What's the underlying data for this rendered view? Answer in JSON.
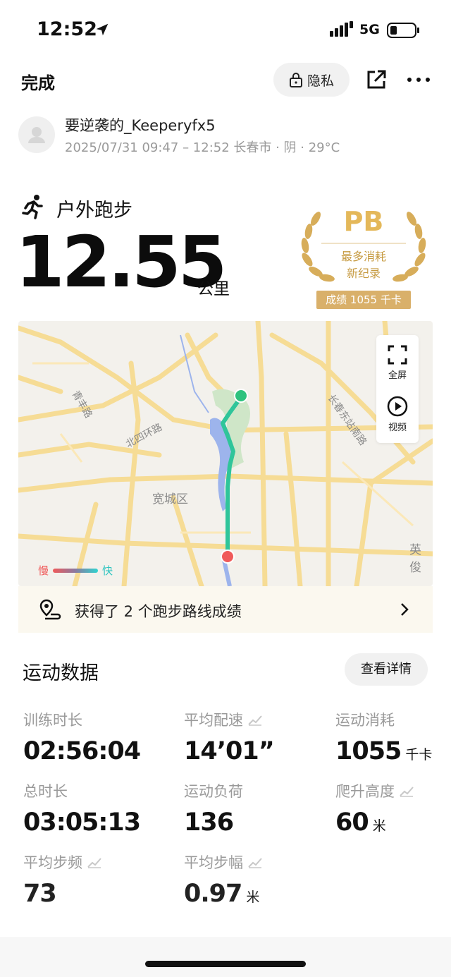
{
  "status_bar": {
    "time": "12:52",
    "network": "5G",
    "icons": [
      "location-arrow-icon",
      "signal-icon",
      "battery-icon"
    ]
  },
  "nav": {
    "done_label": "完成",
    "privacy_label": "隐私",
    "icons": [
      "lock-icon",
      "share-icon",
      "more-icon"
    ]
  },
  "user": {
    "name": "要逆袭的_Keeperyfx5",
    "meta": "2025/07/31 09:47 – 12:52 长春市 · 阴 · 29°C"
  },
  "activity": {
    "type": "户外跑步",
    "distance": "12.55",
    "distance_unit": "公里"
  },
  "pb_badge": {
    "title": "PB",
    "line1": "最多消耗",
    "line2": "新纪录",
    "result": "成绩 1055 千卡"
  },
  "map": {
    "labels": {
      "district": "宽城区",
      "road1": "北四环路",
      "road2": "青丰路",
      "road3": "长春东站南路",
      "edge": "英俊"
    },
    "controls": {
      "fullscreen": "全屏",
      "video": "视频"
    },
    "legend": {
      "slow": "慢",
      "fast": "快"
    },
    "colors": {
      "route_start": "#2ec27e",
      "route_end": "#f05a5a",
      "road": "#f4d98e",
      "water": "#8fa9e8",
      "park": "#cfe6c8"
    }
  },
  "route_banner": {
    "text": "获得了 2 个跑步路线成绩"
  },
  "stats": {
    "title": "运动数据",
    "details_label": "查看详情",
    "items": [
      {
        "label": "训练时长",
        "value": "02:56:04",
        "unit": "",
        "trend": false
      },
      {
        "label": "平均配速",
        "value": "14’01”",
        "unit": "",
        "trend": true
      },
      {
        "label": "运动消耗",
        "value": "1055",
        "unit": "千卡",
        "trend": false
      },
      {
        "label": "总时长",
        "value": "03:05:13",
        "unit": "",
        "trend": false
      },
      {
        "label": "运动负荷",
        "value": "136",
        "unit": "",
        "trend": false
      },
      {
        "label": "爬升高度",
        "value": "60",
        "unit": "米",
        "trend": true
      },
      {
        "label": "平均步频",
        "value": "73",
        "unit": "",
        "trend": true
      },
      {
        "label": "平均步幅",
        "value": "0.97",
        "unit": "米",
        "trend": true
      }
    ]
  }
}
